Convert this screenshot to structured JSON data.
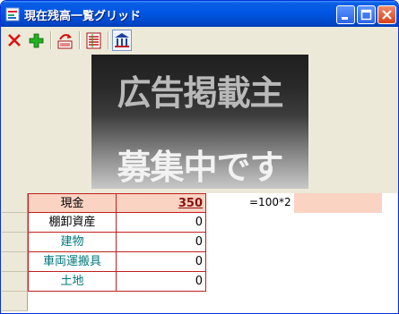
{
  "window": {
    "title": "現在残高一覧グリッド"
  },
  "toolbar": {
    "buttons": [
      {
        "name": "delete-button",
        "icon": "red-x-icon"
      },
      {
        "name": "add-button",
        "icon": "green-plus-icon"
      },
      {
        "name": "refresh-button",
        "icon": "red-arrow-refresh-icon"
      },
      {
        "name": "list-button",
        "icon": "document-list-icon"
      },
      {
        "name": "bank-button",
        "icon": "bank-building-icon"
      }
    ]
  },
  "ad": {
    "line1": "広告掲載主",
    "line2": "募集中です"
  },
  "grid": {
    "rows": [
      {
        "name": "現金",
        "value": "350"
      },
      {
        "name": "棚卸資産",
        "value": "0"
      },
      {
        "name": "建物",
        "value": "0"
      },
      {
        "name": "車両運搬具",
        "value": "0"
      },
      {
        "name": "土地",
        "value": "0"
      }
    ],
    "formula": "=100*2"
  },
  "colors": {
    "title_blue": "#0054e3",
    "grid_red": "#c02020",
    "selection_pink": "#fbd3c3",
    "teal_text": "#00787c"
  }
}
